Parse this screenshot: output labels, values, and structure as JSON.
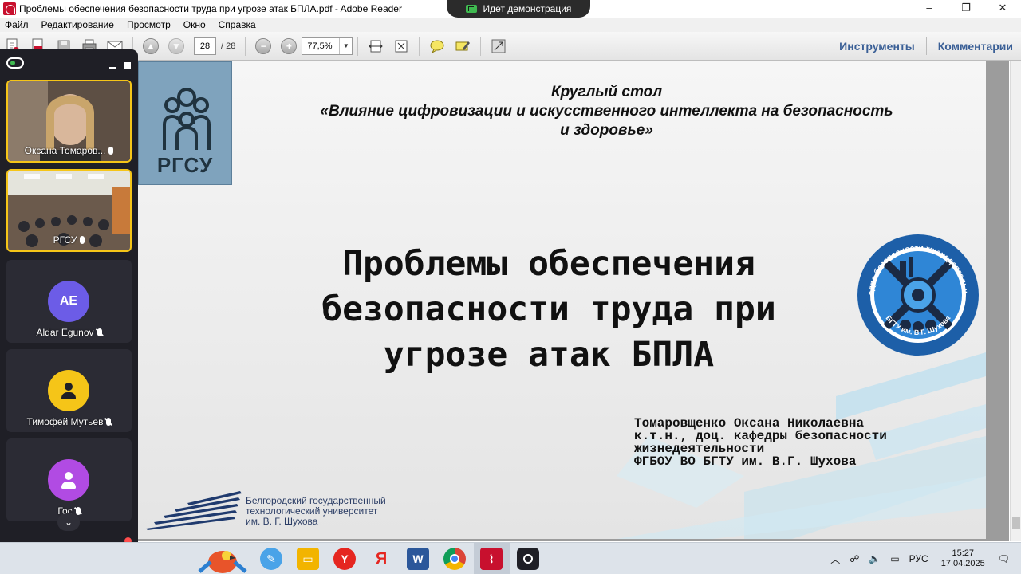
{
  "window": {
    "title": "Проблемы обеспечения безопасности труда при угрозе атак БПЛА.pdf - Adobe Reader",
    "controls": [
      "–",
      "❐",
      "✕"
    ]
  },
  "demo_banner": {
    "label": "Идет демонстрация"
  },
  "menu": {
    "items": [
      "Файл",
      "Редактирование",
      "Просмотр",
      "Окно",
      "Справка"
    ]
  },
  "toolbar": {
    "page_current": "28",
    "page_total": "/ 28",
    "zoom": "77,5%",
    "tools_label": "Инструменты",
    "comments_label": "Комментарии"
  },
  "participants": [
    {
      "name": "Оксана Томаров...",
      "type": "video",
      "muted": false
    },
    {
      "name": "РГСУ",
      "type": "video",
      "muted": false
    },
    {
      "name": "Aldar Egunov",
      "type": "avatar",
      "initials": "AE",
      "color": "#6c5ce7",
      "muted": true
    },
    {
      "name": "Тимофей Мутьев",
      "type": "avatar",
      "initials": "",
      "color": "#f5c518",
      "muted": true
    },
    {
      "name": "Гос",
      "type": "avatar",
      "initials": "",
      "color": "#b14be3",
      "muted": true
    }
  ],
  "slide": {
    "rgsu_label": "РГСУ",
    "round_table": [
      "Круглый стол",
      "«Влияние цифровизации и искусственного интеллекта на безопасность",
      "и здоровье»"
    ],
    "title": [
      "Проблемы обеспечения",
      "безопасности труда при",
      "угрозе атак БПЛА"
    ],
    "author": [
      "Томаровщенко Оксана Николаевна",
      "к.т.н., доц. кафедры безопасности",
      "жизнедеятельности",
      "ФГБОУ ВО БГТУ им. В.Г. Шухова"
    ],
    "dept_logo_text": "Кафедра безопасности жизнедеятельности",
    "dept_logo_bottom": "БГТУ им. В.Г. Шухова",
    "university": [
      "Белгородский государственный",
      "технологический университет",
      "им. В. Г. Шухова"
    ]
  },
  "taskbar": {
    "lang": "РУС",
    "time": "15:27",
    "date": "17.04.2025"
  },
  "colors": {
    "accent_yellow": "#f5c518",
    "adobe_red": "#c8102e",
    "panel_bg": "#1f1f26",
    "link_blue": "#3a5f96"
  }
}
